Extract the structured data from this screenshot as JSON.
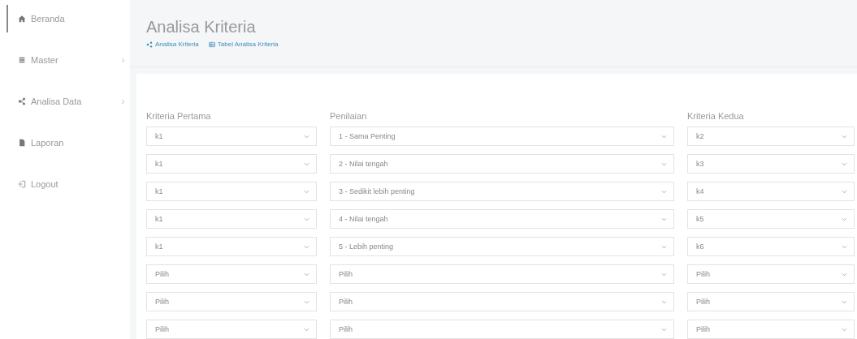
{
  "sidebar": {
    "items": [
      {
        "label": "Beranda",
        "selected": true,
        "has_submenu": false
      },
      {
        "label": "Master",
        "selected": false,
        "has_submenu": true
      },
      {
        "label": "Analisa Data",
        "selected": false,
        "has_submenu": true
      },
      {
        "label": "Laporan",
        "selected": false,
        "has_submenu": false
      },
      {
        "label": "Logout",
        "selected": false,
        "has_submenu": false
      }
    ]
  },
  "page": {
    "title": "Analisa Kriteria",
    "breadcrumb": [
      {
        "label": "Analisa Kriteria"
      },
      {
        "label": "Tabel Analisa Kriteria"
      }
    ]
  },
  "form": {
    "columns": [
      "Kriteria Pertama",
      "Penilaian",
      "Kriteria Kedua"
    ],
    "rows": [
      [
        "k1",
        "1 - Sama Penting",
        "k2"
      ],
      [
        "k1",
        "2 - Nilai tengah",
        "k3"
      ],
      [
        "k1",
        "3 - Sedikit lebih penting",
        "k4"
      ],
      [
        "k1",
        "4 - Nilai tengah",
        "k5"
      ],
      [
        "k1",
        "5 - Lebih penting",
        "k6"
      ],
      [
        "Pilih",
        "Pilih",
        "Pilih"
      ],
      [
        "Pilih",
        "Pilih",
        "Pilih"
      ],
      [
        "Pilih",
        "Pilih",
        "Pilih"
      ]
    ]
  }
}
